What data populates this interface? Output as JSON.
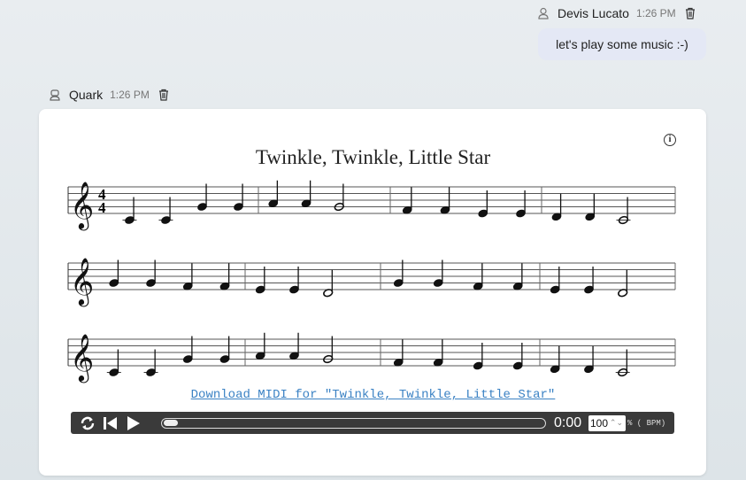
{
  "user_msg": {
    "author": "Devis Lucato",
    "time": "1:26 PM",
    "text": "let's play some music :-)"
  },
  "bot_msg": {
    "author": "Quark",
    "time": "1:26 PM"
  },
  "score": {
    "title": "Twinkle, Twinkle, Little Star",
    "time_signature": [
      "4",
      "4"
    ],
    "systems": [
      [
        [
          "C4",
          "C4",
          "G4",
          "G4"
        ],
        [
          "A4",
          "A4",
          "G4:h"
        ],
        [
          "F4",
          "F4",
          "E4",
          "E4"
        ],
        [
          "D4",
          "D4",
          "C4:h"
        ]
      ],
      [
        [
          "G4",
          "G4",
          "F4",
          "F4"
        ],
        [
          "E4",
          "E4",
          "D4:h"
        ],
        [
          "G4",
          "G4",
          "F4",
          "F4"
        ],
        [
          "E4",
          "E4",
          "D4:h"
        ]
      ],
      [
        [
          "C4",
          "C4",
          "G4",
          "G4"
        ],
        [
          "A4",
          "A4",
          "G4:h"
        ],
        [
          "F4",
          "F4",
          "E4",
          "E4"
        ],
        [
          "D4",
          "D4",
          "C4:h"
        ]
      ]
    ],
    "download_label": "Download MIDI for \"Twinkle, Twinkle, Little Star\""
  },
  "player": {
    "time": "0:00",
    "tempo_value": "100",
    "tempo_unit": "% ( BPM)",
    "progress": 0
  }
}
